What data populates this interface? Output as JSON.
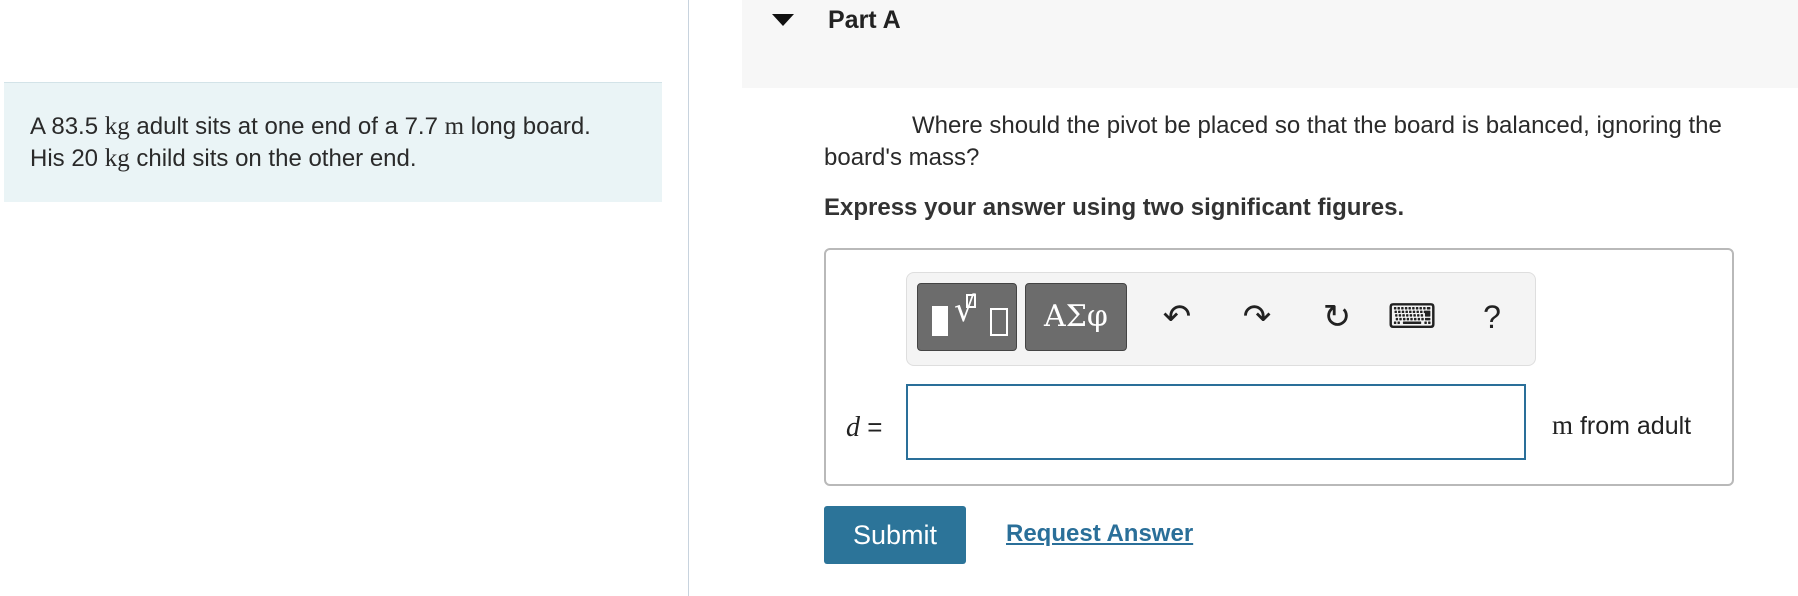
{
  "problem": {
    "t1": "A 83.5 ",
    "u1": "kg",
    "t2": " adult sits at one end of a 7.7 ",
    "u2": "m",
    "t3": " long board. His 20 ",
    "u3": "kg",
    "t4": " child sits on the other end."
  },
  "part": {
    "title": "Part A",
    "question": "Where should the pivot be placed so that the board is balanced, ignoring the board's mass?",
    "instruction": "Express your answer using two significant figures."
  },
  "toolbar": {
    "symbols_label": "ΑΣφ",
    "undo_glyph": "↶",
    "redo_glyph": "↷",
    "reset_glyph": "↻",
    "keyboard_glyph": "⌨",
    "help_label": "?"
  },
  "answer": {
    "variable": "d",
    "equals": "=",
    "value": "",
    "unit": "m",
    "unit_suffix": " from adult"
  },
  "actions": {
    "submit_label": "Submit",
    "request_label": "Request Answer"
  },
  "icons": {
    "toggle": "triangle-down-icon",
    "templates": "templates-icon",
    "undo": "undo-icon",
    "redo": "redo-icon",
    "reset": "reset-icon",
    "keyboard": "keyboard-icon",
    "help": "help-icon"
  },
  "colors": {
    "problem_bg": "#eaf4f6",
    "header_bg": "#f7f7f7",
    "primary": "#2c7499",
    "link": "#2a6f99",
    "tool_button": "#6c6c6c"
  }
}
